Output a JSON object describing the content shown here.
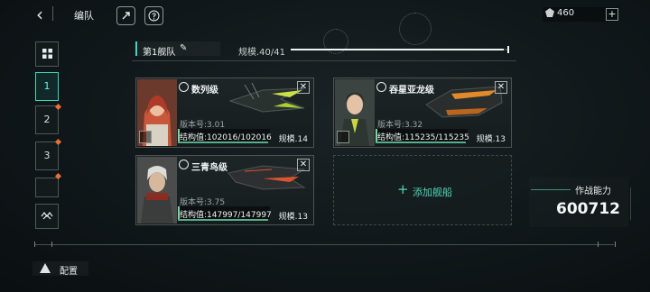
{
  "header": {
    "title": "编队",
    "back_icon": "chevron-left-icon",
    "rocket_icon": "rocket-icon",
    "help_icon": "help-icon",
    "currency_value": "460",
    "currency_add": "+"
  },
  "sidebar": {
    "tabs": [
      "1",
      "2",
      "3",
      ""
    ]
  },
  "fleet": {
    "name": "第1舰队",
    "scale_label": "规模.40/41",
    "scale_current": 40,
    "scale_max": 41
  },
  "ships": [
    {
      "name": "数列级",
      "version": "版本号:3.01",
      "hp": "结构值:102016/102016",
      "hp_fraction": 1.0,
      "scale": "规模.14",
      "accent": "#c9e04a"
    },
    {
      "name": "吞星亚龙级",
      "version": "版本号:3.32",
      "hp": "结构值:115235/115235",
      "hp_fraction": 1.0,
      "scale": "规模.13",
      "accent": "#e08a2a"
    },
    {
      "name": "三青鸟级",
      "version": "版本号:3.75",
      "hp": "结构值:147997/147997",
      "hp_fraction": 1.0,
      "scale": "规模.13",
      "accent": "#d9552e"
    }
  ],
  "add_ship": {
    "label": "添加舰船",
    "plus": "+"
  },
  "combat_power": {
    "label": "作战能力",
    "value": "600712"
  },
  "footer": {
    "config_label": "配置"
  },
  "colors": {
    "accent_teal": "#3dd6c0",
    "alert_orange": "#e7703a",
    "hp_green": "#55b08a"
  }
}
